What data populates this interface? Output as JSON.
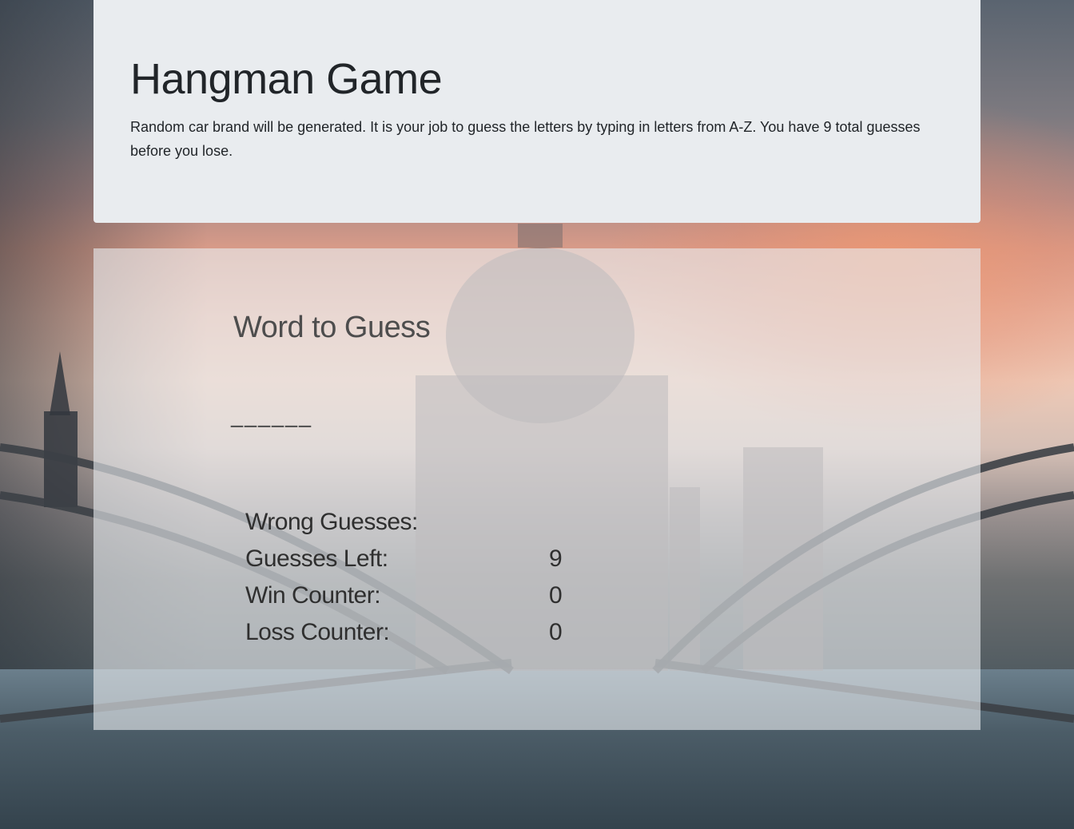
{
  "jumbotron": {
    "title": "Hangman Game",
    "description": "Random car brand will be generated. It is your job to guess the letters by typing in letters from A-Z. You have 9 total guesses before you lose."
  },
  "game": {
    "word_title": "Word to Guess",
    "word_blanks": "______",
    "stats": {
      "wrong_guesses_label": "Wrong Guesses:",
      "wrong_guesses_value": "",
      "guesses_left_label": "Guesses Left:",
      "guesses_left_value": "9",
      "win_counter_label": "Win Counter:",
      "win_counter_value": "0",
      "loss_counter_label": "Loss Counter:",
      "loss_counter_value": "0"
    }
  },
  "colors": {
    "jumbotron_bg": "#e9ecef",
    "panel_bg": "rgba(233,236,239,0.62)",
    "text": "#212529"
  }
}
